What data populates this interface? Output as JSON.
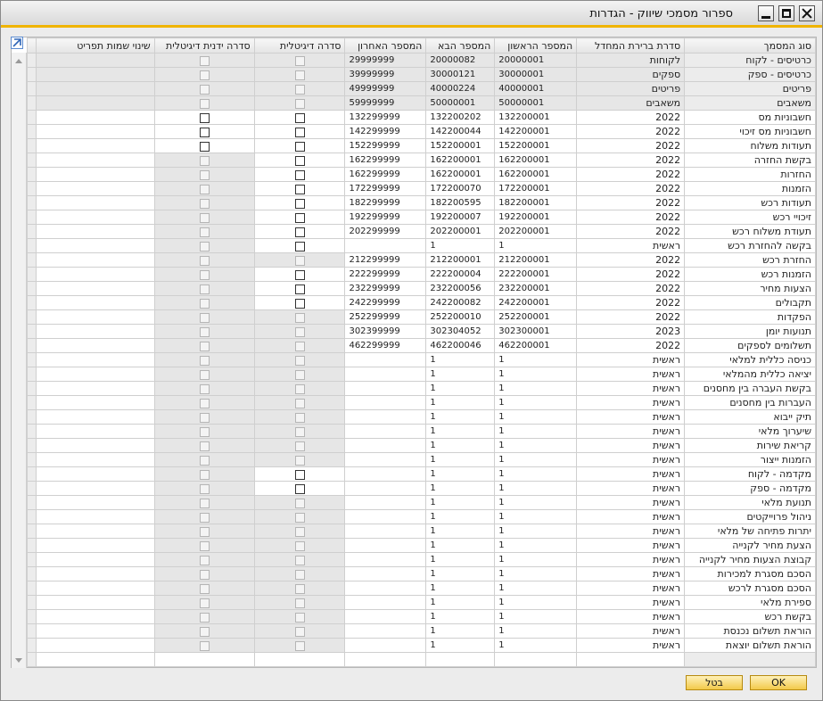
{
  "window": {
    "title": "ספרור מסמכי שיווק - הגדרות"
  },
  "columns": [
    "סוג המסמך",
    "סדרת ברירת המחדל",
    "המספר הראשון",
    "המספר הבא",
    "המספר האחרון",
    "סדרה דיגיטלית",
    "סדרה ידנית דיגיטלית",
    "שינוי שמות תפריט"
  ],
  "rows": [
    {
      "name": "כרטיסים - לקוח",
      "series": "לקוחות",
      "first": "20000001",
      "next": "20000082",
      "last": "29999999",
      "dig": "d",
      "man": "d"
    },
    {
      "name": "כרטיסים - ספק",
      "series": "ספקים",
      "first": "30000001",
      "next": "30000121",
      "last": "39999999",
      "dig": "d",
      "man": "d"
    },
    {
      "name": "פריטים",
      "series": "פריטים",
      "first": "40000001",
      "next": "40000224",
      "last": "49999999",
      "dig": "d",
      "man": "d"
    },
    {
      "name": "משאבים",
      "series": "משאבים",
      "first": "50000001",
      "next": "50000001",
      "last": "59999999",
      "dig": "d",
      "man": "d"
    },
    {
      "name": "חשבוניות מס",
      "series": "2022",
      "first": "132200001",
      "next": "132200202",
      "last": "132299999",
      "dig": "e",
      "man": "e"
    },
    {
      "name": "חשבוניות מס זיכוי",
      "series": "2022",
      "first": "142200001",
      "next": "142200044",
      "last": "142299999",
      "dig": "e",
      "man": "e"
    },
    {
      "name": "תעודות משלוח",
      "series": "2022",
      "first": "152200001",
      "next": "152200001",
      "last": "152299999",
      "dig": "e",
      "man": "e"
    },
    {
      "name": "בקשת החזרה",
      "series": "2022",
      "first": "162200001",
      "next": "162200001",
      "last": "162299999",
      "dig": "e",
      "man": "d"
    },
    {
      "name": "החזרות",
      "series": "2022",
      "first": "162200001",
      "next": "162200001",
      "last": "162299999",
      "dig": "e",
      "man": "d"
    },
    {
      "name": "הזמנות",
      "series": "2022",
      "first": "172200001",
      "next": "172200070",
      "last": "172299999",
      "dig": "e",
      "man": "d"
    },
    {
      "name": "תעודות רכש",
      "series": "2022",
      "first": "182200001",
      "next": "182200595",
      "last": "182299999",
      "dig": "e",
      "man": "d"
    },
    {
      "name": "זיכויי רכש",
      "series": "2022",
      "first": "192200001",
      "next": "192200007",
      "last": "192299999",
      "dig": "e",
      "man": "d"
    },
    {
      "name": "תעודת משלוח רכש",
      "series": "2022",
      "first": "202200001",
      "next": "202200001",
      "last": "202299999",
      "dig": "e",
      "man": "d"
    },
    {
      "name": "בקשה להחזרת רכש",
      "series": "ראשית",
      "first": "1",
      "next": "1",
      "last": "",
      "dig": "e",
      "man": "d"
    },
    {
      "name": "החזרת רכש",
      "series": "2022",
      "first": "212200001",
      "next": "212200001",
      "last": "212299999",
      "dig": "d",
      "man": "d"
    },
    {
      "name": "הזמנות רכש",
      "series": "2022",
      "first": "222200001",
      "next": "222200004",
      "last": "222299999",
      "dig": "e",
      "man": "d"
    },
    {
      "name": "הצעות מחיר",
      "series": "2022",
      "first": "232200001",
      "next": "232200056",
      "last": "232299999",
      "dig": "e",
      "man": "d"
    },
    {
      "name": "תקבולים",
      "series": "2022",
      "first": "242200001",
      "next": "242200082",
      "last": "242299999",
      "dig": "e",
      "man": "d"
    },
    {
      "name": "הפקדות",
      "series": "2022",
      "first": "252200001",
      "next": "252200010",
      "last": "252299999",
      "dig": "d",
      "man": "d"
    },
    {
      "name": "תנועות יומן",
      "series": "2023",
      "first": "302300001",
      "next": "302304052",
      "last": "302399999",
      "dig": "d",
      "man": "d"
    },
    {
      "name": "תשלומים לספקים",
      "series": "2022",
      "first": "462200001",
      "next": "462200046",
      "last": "462299999",
      "dig": "d",
      "man": "d"
    },
    {
      "name": "כניסה כללית למלאי",
      "series": "ראשית",
      "first": "1",
      "next": "1",
      "last": "",
      "dig": "d",
      "man": "d"
    },
    {
      "name": "יציאה כללית מהמלאי",
      "series": "ראשית",
      "first": "1",
      "next": "1",
      "last": "",
      "dig": "d",
      "man": "d"
    },
    {
      "name": "בקשת העברה בין מחסנים",
      "series": "ראשית",
      "first": "1",
      "next": "1",
      "last": "",
      "dig": "d",
      "man": "d"
    },
    {
      "name": "העברות בין מחסנים",
      "series": "ראשית",
      "first": "1",
      "next": "1",
      "last": "",
      "dig": "d",
      "man": "d"
    },
    {
      "name": "תיק ייבוא",
      "series": "ראשית",
      "first": "1",
      "next": "1",
      "last": "",
      "dig": "d",
      "man": "d"
    },
    {
      "name": "שיערוך מלאי",
      "series": "ראשית",
      "first": "1",
      "next": "1",
      "last": "",
      "dig": "d",
      "man": "d"
    },
    {
      "name": "קריאת שירות",
      "series": "ראשית",
      "first": "1",
      "next": "1",
      "last": "",
      "dig": "d",
      "man": "d"
    },
    {
      "name": "הזמנות ייצור",
      "series": "ראשית",
      "first": "1",
      "next": "1",
      "last": "",
      "dig": "d",
      "man": "d"
    },
    {
      "name": "מקדמה - לקוח",
      "series": "ראשית",
      "first": "1",
      "next": "1",
      "last": "",
      "dig": "e",
      "man": "d"
    },
    {
      "name": "מקדמה - ספק",
      "series": "ראשית",
      "first": "1",
      "next": "1",
      "last": "",
      "dig": "e",
      "man": "d"
    },
    {
      "name": "תנועת מלאי",
      "series": "ראשית",
      "first": "1",
      "next": "1",
      "last": "",
      "dig": "d",
      "man": "d"
    },
    {
      "name": "ניהול פרוייקטים",
      "series": "ראשית",
      "first": "1",
      "next": "1",
      "last": "",
      "dig": "d",
      "man": "d"
    },
    {
      "name": "יתרות פתיחה של מלאי",
      "series": "ראשית",
      "first": "1",
      "next": "1",
      "last": "",
      "dig": "d",
      "man": "d"
    },
    {
      "name": "הצעת מחיר לקנייה",
      "series": "ראשית",
      "first": "1",
      "next": "1",
      "last": "",
      "dig": "d",
      "man": "d"
    },
    {
      "name": "קבוצת הצעות מחיר לקנייה",
      "series": "ראשית",
      "first": "1",
      "next": "1",
      "last": "",
      "dig": "d",
      "man": "d"
    },
    {
      "name": "הסכם מסגרת למכירות",
      "series": "ראשית",
      "first": "1",
      "next": "1",
      "last": "",
      "dig": "d",
      "man": "d"
    },
    {
      "name": "הסכם מסגרת לרכש",
      "series": "ראשית",
      "first": "1",
      "next": "1",
      "last": "",
      "dig": "d",
      "man": "d"
    },
    {
      "name": "ספירת מלאי",
      "series": "ראשית",
      "first": "1",
      "next": "1",
      "last": "",
      "dig": "d",
      "man": "d"
    },
    {
      "name": "בקשת רכש",
      "series": "ראשית",
      "first": "1",
      "next": "1",
      "last": "",
      "dig": "d",
      "man": "d"
    },
    {
      "name": "הוראת תשלום נכנסת",
      "series": "ראשית",
      "first": "1",
      "next": "1",
      "last": "",
      "dig": "d",
      "man": "d"
    },
    {
      "name": "הוראת תשלום יוצאת",
      "series": "ראשית",
      "first": "1",
      "next": "1",
      "last": "",
      "dig": "d",
      "man": "d"
    }
  ],
  "buttons": {
    "ok": "OK",
    "cancel": "בטל"
  }
}
